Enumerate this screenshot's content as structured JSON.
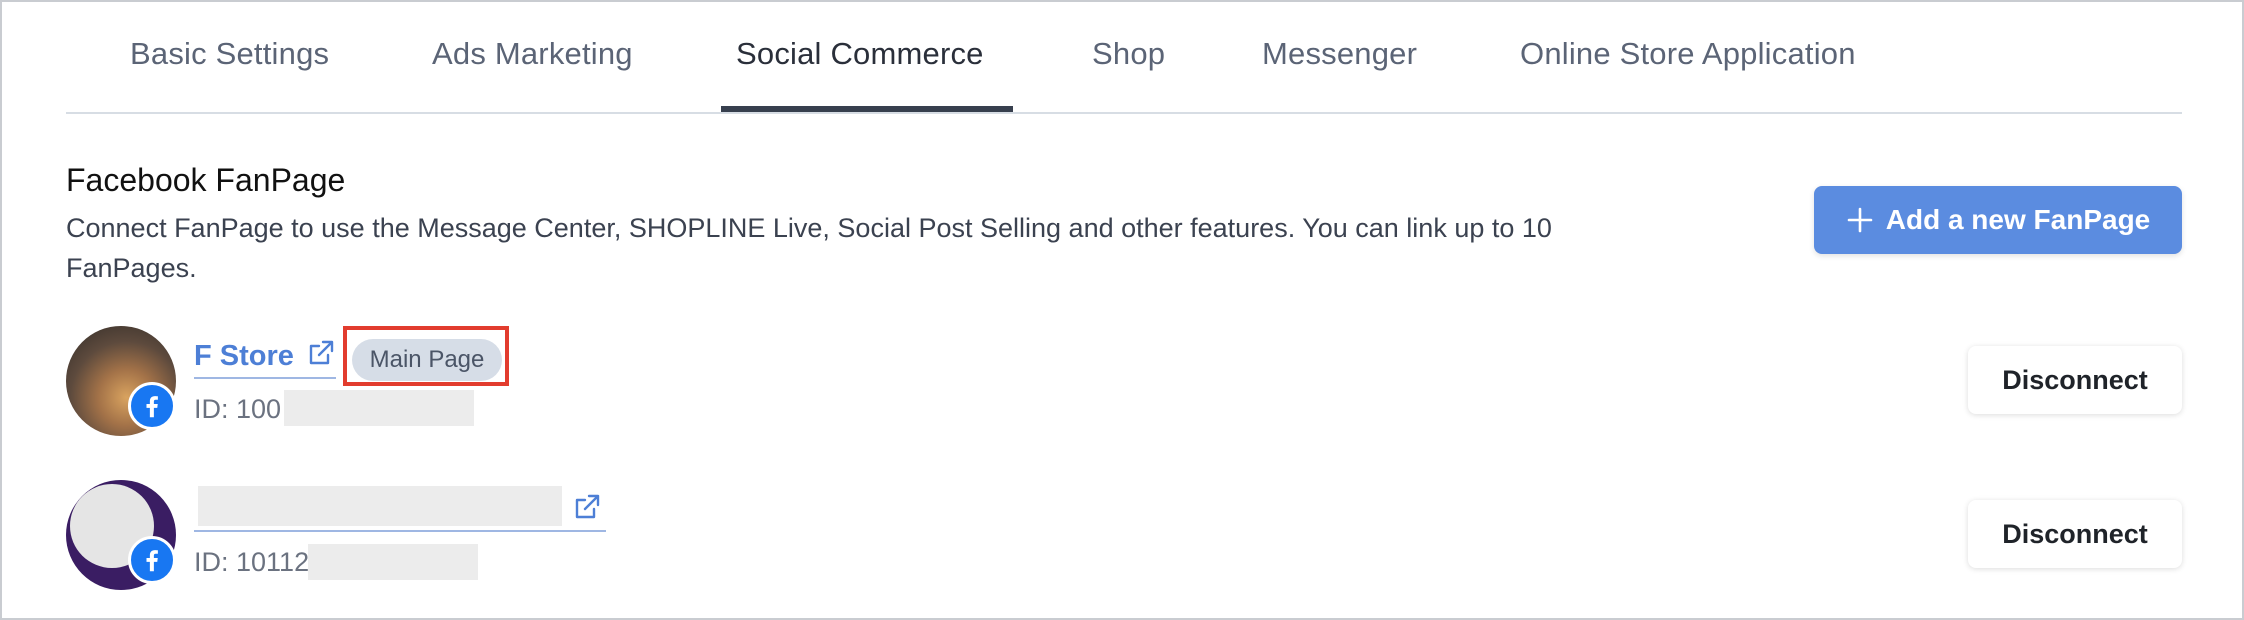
{
  "tabs": [
    {
      "label": "Basic Settings",
      "active": false
    },
    {
      "label": "Ads Marketing",
      "active": false
    },
    {
      "label": "Social Commerce",
      "active": true
    },
    {
      "label": "Shop",
      "active": false
    },
    {
      "label": "Messenger",
      "active": false
    },
    {
      "label": "Online Store Application",
      "active": false
    }
  ],
  "section": {
    "title": "Facebook FanPage",
    "description": "Connect FanPage to use the Message Center, SHOPLINE Live, Social Post Selling and other features. You can link up to 10 FanPages.",
    "add_button_label": "Add a new FanPage"
  },
  "fanpages": [
    {
      "name": "F Store",
      "badge": "Main Page",
      "id_prefix": "ID: 100",
      "action_label": "Disconnect"
    },
    {
      "name": "",
      "badge": "",
      "id_prefix": "ID: 10112",
      "action_label": "Disconnect"
    }
  ],
  "colors": {
    "accent": "#5b8ce0",
    "link": "#4d7fd6",
    "facebook": "#1877f2",
    "highlight": "#e23c2e",
    "active_tab_underline": "#373f4e"
  },
  "icons": [
    "plus-icon",
    "external-link-icon",
    "facebook-icon"
  ]
}
